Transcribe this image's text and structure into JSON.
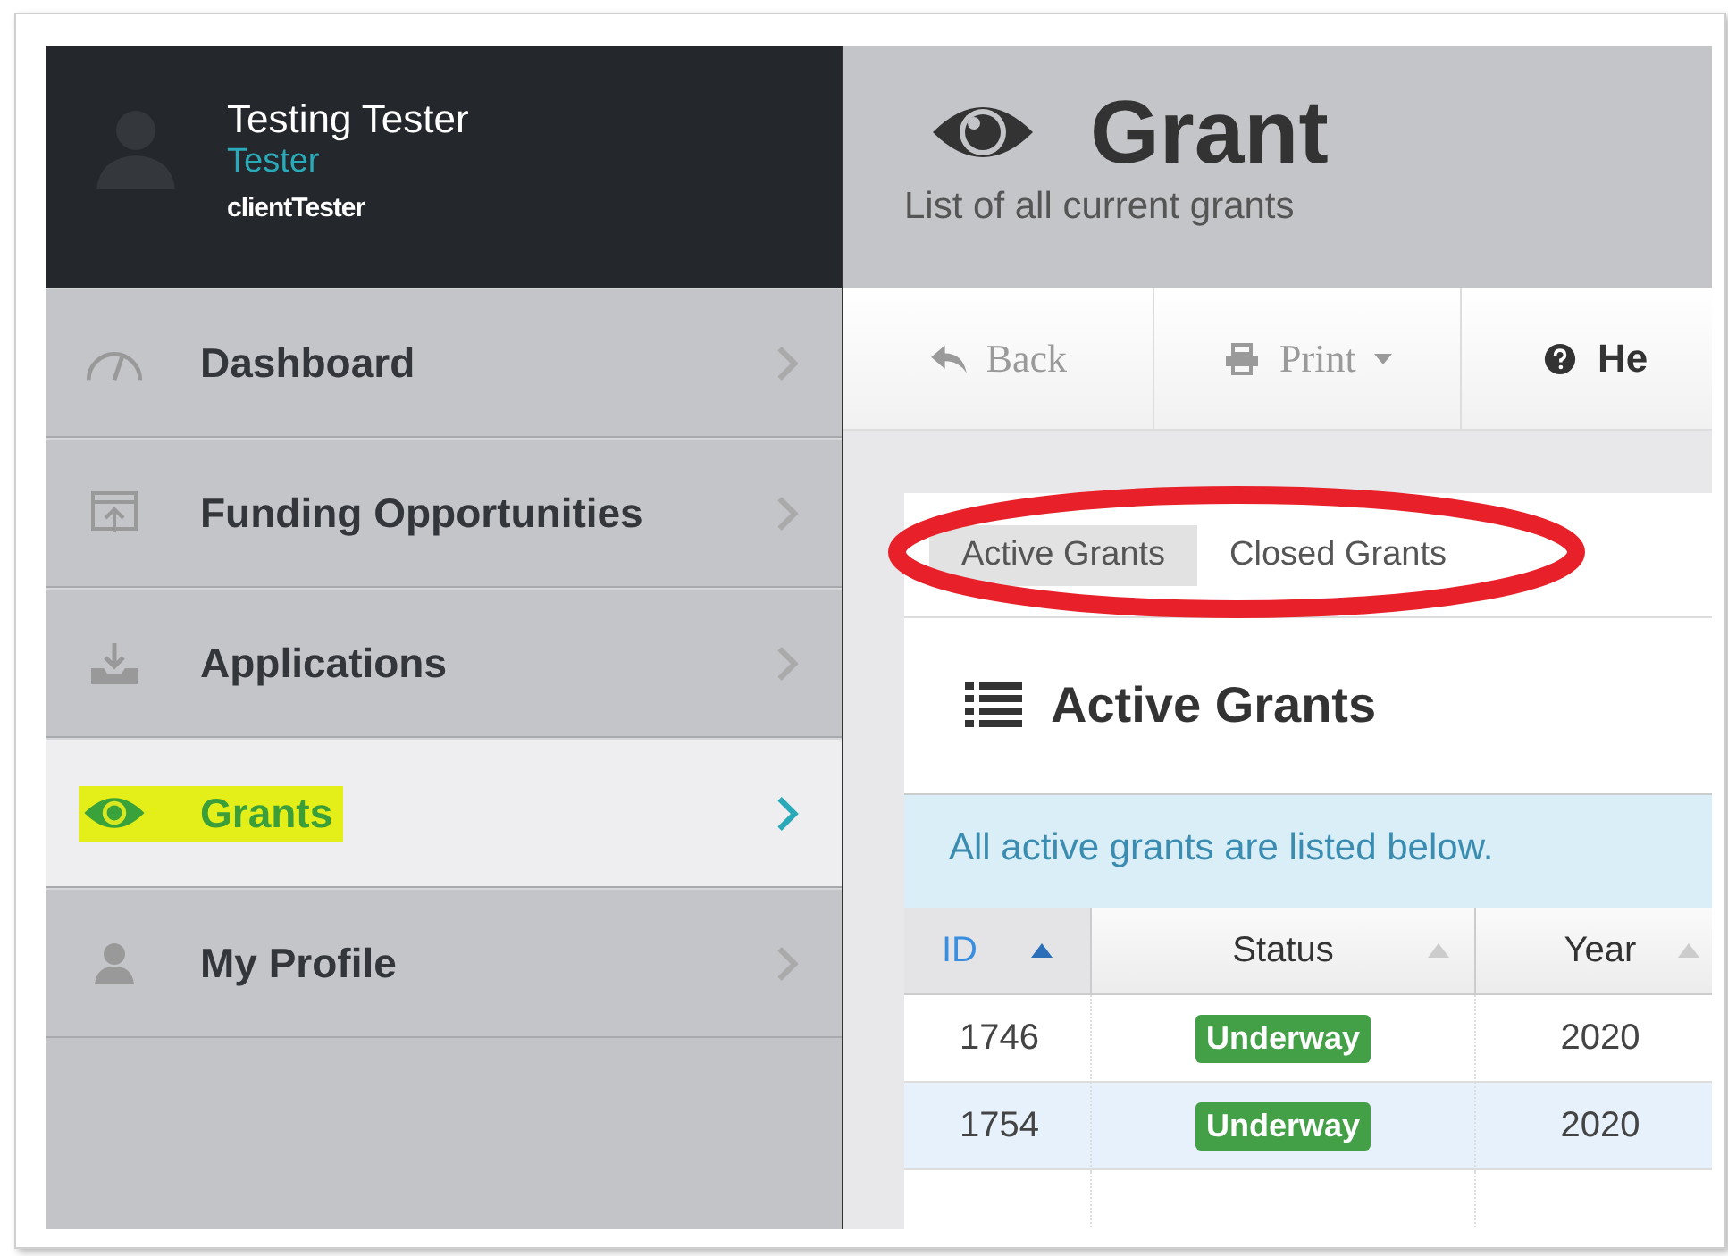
{
  "user": {
    "name": "Testing Tester",
    "role": "Tester",
    "username": "clientTester"
  },
  "sidebar": {
    "items": [
      {
        "label": "Dashboard",
        "selected": false,
        "highlighted": false
      },
      {
        "label": "Funding Opportunities",
        "selected": false,
        "highlighted": false
      },
      {
        "label": "Applications",
        "selected": false,
        "highlighted": false
      },
      {
        "label": "Grants",
        "selected": true,
        "highlighted": true
      },
      {
        "label": "My Profile",
        "selected": false,
        "highlighted": false
      }
    ]
  },
  "header": {
    "title": "Grant",
    "subtitle": "List of all current grants"
  },
  "toolbar": [
    {
      "label": "Back",
      "disabled": true
    },
    {
      "label": "Print",
      "disabled": true
    },
    {
      "label": "He",
      "disabled": false
    }
  ],
  "tabs": [
    {
      "label": "Active Grants",
      "selected": true
    },
    {
      "label": "Closed Grants",
      "selected": false
    }
  ],
  "annotation": {
    "circled": true
  },
  "panel": {
    "title": "Active Grants",
    "info": "All active grants are listed below."
  },
  "table": {
    "columns": [
      {
        "label": "ID",
        "sorted": true
      },
      {
        "label": "Status",
        "sorted": false
      },
      {
        "label": "Year",
        "sorted": false
      }
    ],
    "rows": [
      {
        "id": "1746",
        "status": "Underway",
        "year": "2020",
        "selected": false
      },
      {
        "id": "1754",
        "status": "Underway",
        "year": "2020",
        "selected": true
      }
    ]
  }
}
